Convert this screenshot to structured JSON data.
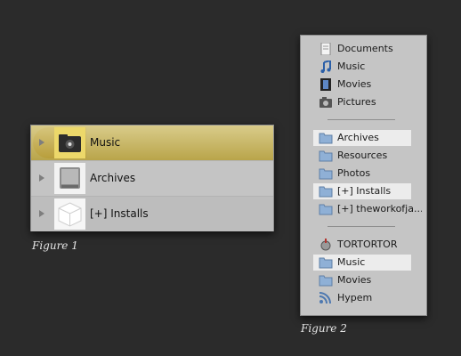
{
  "figure1": {
    "caption": "Figure 1",
    "rows": [
      {
        "label": "Music",
        "selected": true
      },
      {
        "label": "Archives",
        "selected": false
      },
      {
        "label": "[+] Installs",
        "selected": false
      }
    ]
  },
  "figure2": {
    "caption": "Figure 2",
    "groups": [
      {
        "items": [
          "Documents",
          "Music",
          "Movies",
          "Pictures"
        ]
      },
      {
        "items": [
          "Archives",
          "Resources",
          "Photos",
          "[+] Installs",
          "[+] theworkofja..."
        ]
      },
      {
        "items": [
          "TORTORTOR",
          "Music",
          "Movies",
          "Hypem"
        ]
      }
    ]
  },
  "colors": {
    "background": "#2b2b2b",
    "highlight_gold": "#c9b55a",
    "panel": "#c5c5c5"
  }
}
